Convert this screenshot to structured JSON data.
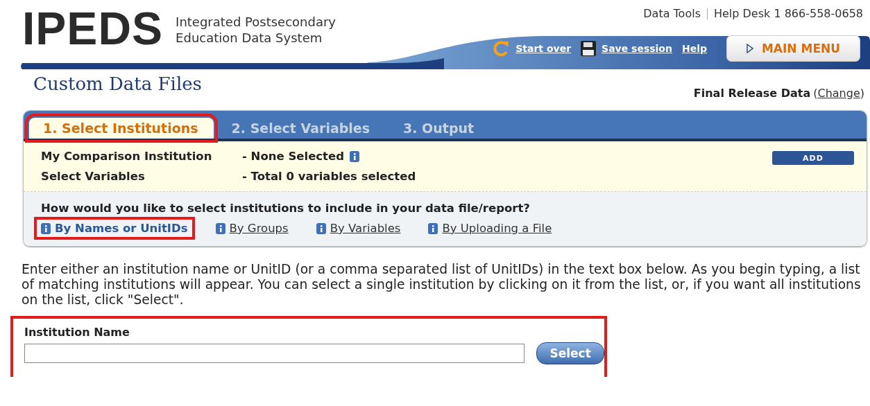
{
  "logo": {
    "wordmark": "IPEDS",
    "subtitle_lines": [
      "Integrated Postsecondary",
      "Education Data System"
    ]
  },
  "top_links": [
    {
      "label": "Data Tools"
    },
    {
      "label": "Help Desk 1 866-558-0658"
    }
  ],
  "toolbar": [
    {
      "kind": "restart",
      "label": "Start over"
    },
    {
      "kind": "save",
      "label": "Save session"
    },
    {
      "kind": "plain",
      "label": "Help"
    }
  ],
  "main_menu": {
    "label": "MAIN MENU"
  },
  "page_title": "Custom Data Files",
  "release": {
    "label": "Final Release Data",
    "open": "(",
    "link": "Change",
    "close": ")"
  },
  "tabs": [
    {
      "label": "1. Select Institutions",
      "selected": true,
      "highlighted": true
    },
    {
      "label": "2. Select Variables",
      "selected": false,
      "highlighted": false
    },
    {
      "label": "3. Output",
      "selected": false,
      "highlighted": false
    }
  ],
  "summary": [
    {
      "label": "My Comparison Institution",
      "value": "- None Selected",
      "info": true
    },
    {
      "label": "Select Variables",
      "value": "- Total 0 variables selected",
      "info": false
    }
  ],
  "add_button": "ADD",
  "method_question": "How would you like to select institutions to include in your data file/report?",
  "methods": [
    {
      "label": "By Names or UnitIDs",
      "selected": true,
      "highlighted": true
    },
    {
      "label": "By Groups",
      "selected": false,
      "highlighted": false
    },
    {
      "label": "By Variables",
      "selected": false,
      "highlighted": false
    },
    {
      "label": "By Uploading a File",
      "selected": false,
      "highlighted": false
    }
  ],
  "instructions": "Enter either an institution name or UnitID (or a comma separated list of UnitIDs) in the text box below. As you begin typing, a list of matching institutions will appear. You can select a single institution by clicking on it from the list, or, if you want all institutions on the list, click \"Select\".",
  "institution_field": {
    "label": "Institution Name",
    "highlighted": true,
    "button": "Select"
  }
}
